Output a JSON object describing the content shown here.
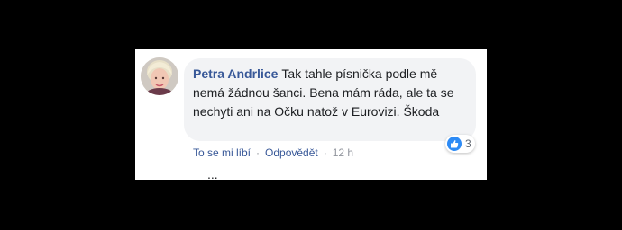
{
  "comment": {
    "author": "Petra Andrlice",
    "text": "Tak tahle písnička podle mě nemá žádnou šanci. Bena mám ráda, ale ta se nechyti ani na Očku natož v Eurovizi. Škoda",
    "reactions": {
      "icon": "like-icon",
      "count": "3",
      "color": "#2e8bf5"
    },
    "actions": {
      "like": "To se mi líbí",
      "reply": "Odpovědět",
      "separator": "·",
      "time": "12 h"
    }
  },
  "next_comment_fragment": "...",
  "colors": {
    "author": "#385898",
    "bubble": "#f2f3f5",
    "meta": "#90949c"
  }
}
